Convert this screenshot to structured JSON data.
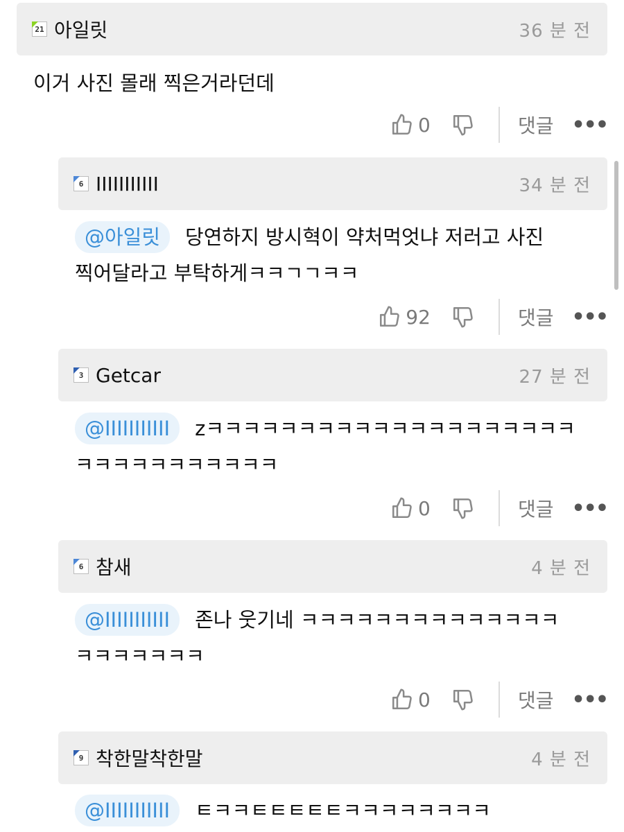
{
  "comments": [
    {
      "username": "아일릿",
      "level": "21",
      "level_color": "#8bd324",
      "time": "36 분 전",
      "mention": "",
      "line1": "이거 사진 몰래 찍은거라던데",
      "line2": "",
      "likes": "0",
      "reply": "댓글"
    },
    {
      "username": "IIIIIIIIIII",
      "level": "6",
      "level_color": "#4d87d6",
      "time": "34 분 전",
      "mention": "@아일릿",
      "line1": "당연하지 방시혁이 약처먹엇냐 저러고 사진",
      "line2": "찍어달라고 부탁하게ㅋㅋㄱㄱㅋㅋ",
      "likes": "92",
      "reply": "댓글"
    },
    {
      "username": "Getcar",
      "level": "3",
      "level_color": "#2f5fb0",
      "time": "27 분 전",
      "mention": "@IIIIIIIIIII",
      "line1": "zㅋㅋㅋㅋㅋㅋㅋㅋㅋㅋㅋㅋㅋㅋㅋㅋㅋㅋㅋㅋ",
      "line2": "ㅋㅋㅋㅋㅋㅋㅋㅋㅋㅋㅋ",
      "likes": "0",
      "reply": "댓글"
    },
    {
      "username": "참새",
      "level": "6",
      "level_color": "#4d87d6",
      "time": "4 분 전",
      "mention": "@IIIIIIIIIII",
      "line1": "존나 웃기네 ㅋㅋㅋㅋㅋㅋㅋㅋㅋㅋㅋㅋㅋㅋ",
      "line2": "ㅋㅋㅋㅋㅋㅋㅋ",
      "likes": "0",
      "reply": "댓글"
    },
    {
      "username": "착한말착한말",
      "level": "9",
      "level_color": "#2f5fb0",
      "time": "4 분 전",
      "mention": "@IIIIIIIIIII",
      "line1": "ㅌㅋㅋㅌㅌㅌㅌㅌㅋㅋㅋㅋㅋㅋㅋㅋ",
      "line2": "",
      "likes": "",
      "reply": ""
    }
  ],
  "icons": {
    "like": "thumbs-up-icon",
    "dislike": "thumbs-down-icon",
    "more": "more-dots-icon"
  },
  "more_glyph": "•••"
}
